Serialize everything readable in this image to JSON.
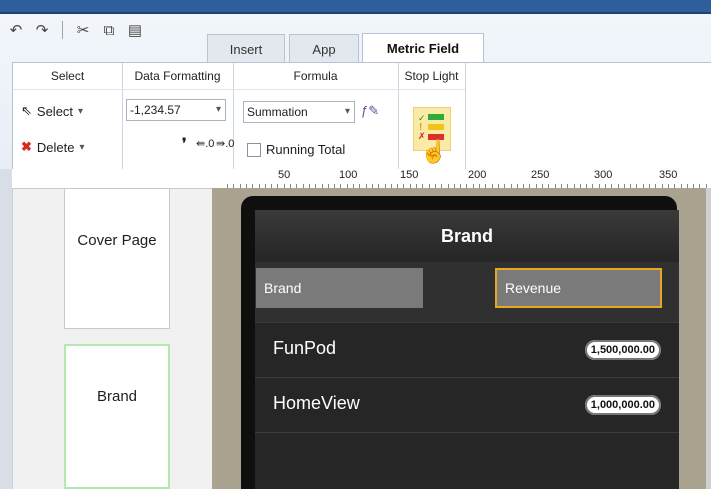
{
  "quick_access": {
    "icons": [
      "undo-icon",
      "redo-icon",
      "cut-icon",
      "copy-icon",
      "paste-icon"
    ]
  },
  "tabs": [
    {
      "label": "Insert",
      "active": false
    },
    {
      "label": "App",
      "active": false
    },
    {
      "label": "Metric Field",
      "active": true
    }
  ],
  "ribbon": {
    "select_group": {
      "title": "Select",
      "select_label": "Select",
      "delete_label": "Delete"
    },
    "data_formatting": {
      "title": "Data Formatting",
      "number_format_value": "-1,234.57"
    },
    "formula": {
      "title": "Formula",
      "function_value": "Summation",
      "running_total_label": "Running Total",
      "running_total_checked": false
    },
    "stop_light": {
      "title": "Stop Light"
    }
  },
  "ruler": {
    "labels": [
      "50",
      "100",
      "150",
      "200",
      "250",
      "300",
      "350"
    ]
  },
  "pages": [
    {
      "label": "Cover Page",
      "selected": false
    },
    {
      "label": "Brand",
      "selected": true
    }
  ],
  "preview": {
    "title": "Brand",
    "header": {
      "left": "Brand",
      "right": "Revenue"
    },
    "rows": [
      {
        "label": "FunPod",
        "value": "1,500,000.00"
      },
      {
        "label": "HomeView",
        "value": "1,000,000.00"
      }
    ]
  },
  "colors": {
    "accent": "#2f5f9a",
    "selected_header_border": "#e5a823",
    "selected_page_border": "#b7e7b1"
  }
}
